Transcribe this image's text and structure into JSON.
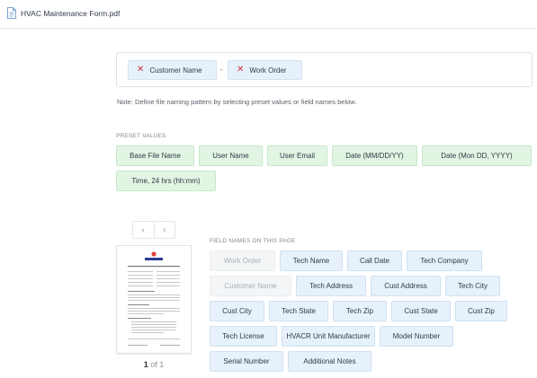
{
  "header": {
    "file_name": "HVAC Maintenance Form.pdf"
  },
  "pattern": {
    "chips": [
      "Customer Name",
      "Work Order"
    ],
    "separator": "-",
    "remove_glyph": "✕"
  },
  "note": "Note: Define file naming pattern by selecting preset values or field names below.",
  "presets": {
    "label": "PRESET VALUES",
    "items": [
      "Base File Name",
      "User Name",
      "User Email",
      "Date (MM/DD/YY)",
      "Date (Mon DD, YYYY)",
      "Time, 24 hrs (hh:mm)"
    ]
  },
  "pager": {
    "prev": "‹",
    "next": "›",
    "current": "1",
    "of_text": "of 1"
  },
  "fields": {
    "label": "FIELD NAMES ON THIS PAGE",
    "items": [
      "Work Order",
      "Tech Name",
      "Call Date",
      "Tech Company",
      "Customer Name",
      "Tech Address",
      "Cust Address",
      "Tech City",
      "Cust City",
      "Tech State",
      "Tech Zip",
      "Cust State",
      "Cust Zip",
      "Tech License",
      "HVACR Unit Manufacturer",
      "Model Number",
      "Serial Number",
      "Additional Notes"
    ],
    "disabled": [
      "Work Order",
      "Customer Name"
    ]
  },
  "colors": {
    "preset_bg": "#e2f5e3",
    "field_bg": "#e7f1fb",
    "disabled_text": "#a8b0b8",
    "remove_x": "#d0343f"
  }
}
